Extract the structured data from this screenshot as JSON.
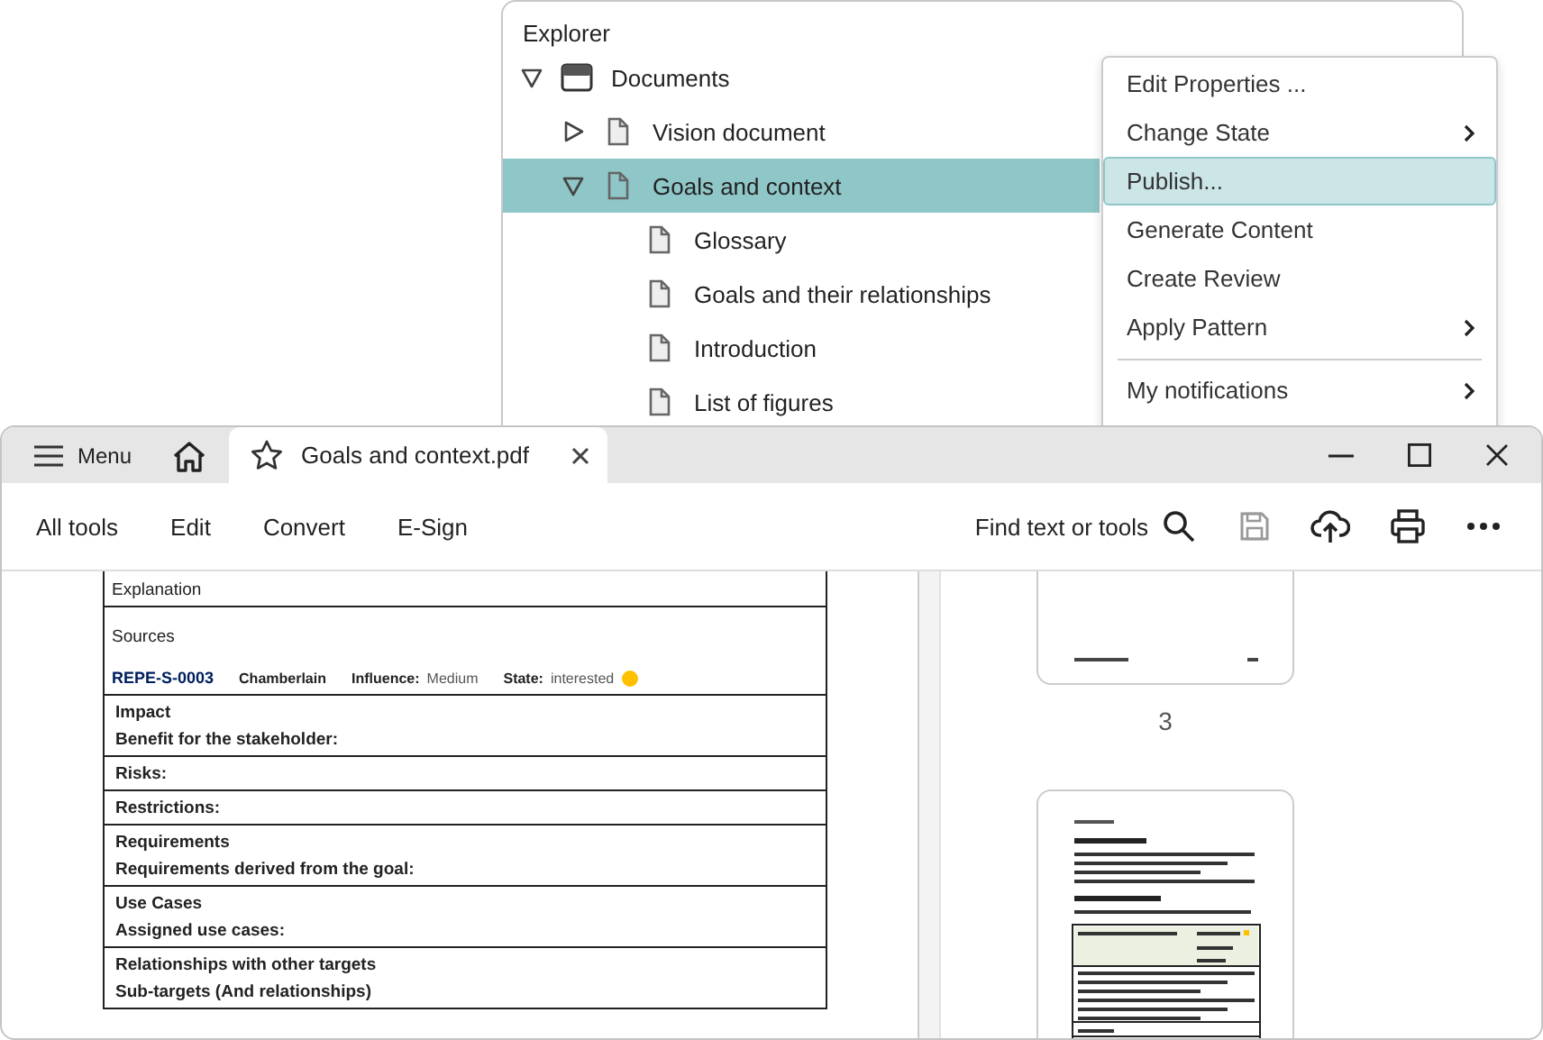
{
  "explorer": {
    "title": "Explorer",
    "tree": [
      {
        "label": "Documents",
        "kind": "folder",
        "expanded": true,
        "selected": false,
        "children": [
          {
            "label": "Vision document",
            "kind": "document",
            "expanded": false,
            "selected": false
          },
          {
            "label": "Goals and context",
            "kind": "document",
            "expanded": true,
            "selected": true,
            "children": [
              {
                "label": "Glossary",
                "kind": "document",
                "selected": false
              },
              {
                "label": "Goals and their relationships",
                "kind": "document",
                "selected": false
              },
              {
                "label": "Introduction",
                "kind": "document",
                "selected": false
              },
              {
                "label": "List of figures",
                "kind": "document",
                "selected": false
              }
            ]
          }
        ]
      }
    ]
  },
  "context_menu": {
    "items": [
      {
        "kind": "item",
        "label": "Edit Properties ...",
        "submenu": false,
        "selected": false
      },
      {
        "kind": "item",
        "label": "Change State",
        "submenu": true,
        "selected": false
      },
      {
        "kind": "item",
        "label": "Publish...",
        "submenu": false,
        "selected": true
      },
      {
        "kind": "item",
        "label": "Generate Content",
        "submenu": false,
        "selected": false
      },
      {
        "kind": "item",
        "label": "Create Review",
        "submenu": false,
        "selected": false
      },
      {
        "kind": "item",
        "label": "Apply Pattern",
        "submenu": true,
        "selected": false
      },
      {
        "kind": "separator"
      },
      {
        "kind": "item",
        "label": "My notifications",
        "submenu": true,
        "selected": false
      }
    ]
  },
  "pdf_window": {
    "menu_button": "Menu",
    "tab": {
      "title": "Goals and context.pdf",
      "selected": true
    },
    "tools": [
      "All tools",
      "Edit",
      "Convert",
      "E-Sign"
    ],
    "search_label": "Find text or tools",
    "actions": [
      {
        "kind": "save",
        "disabled": true
      },
      {
        "kind": "upload",
        "disabled": false
      },
      {
        "kind": "print",
        "disabled": false
      },
      {
        "kind": "more",
        "disabled": false
      }
    ],
    "document": {
      "rows": [
        {
          "kind": "plain",
          "lines": [
            "Explanation"
          ]
        },
        {
          "kind": "sources",
          "title": "Sources",
          "entry": {
            "id": "REPE-S-0003",
            "name": "Chamberlain",
            "influence_label": "Influence:",
            "influence": "Medium",
            "state_label": "State:",
            "state": "interested",
            "color": "#ffc000"
          }
        },
        {
          "kind": "section",
          "lines": [
            "Impact",
            "Benefit for the stakeholder:"
          ]
        },
        {
          "kind": "section",
          "lines": [
            "Risks:"
          ]
        },
        {
          "kind": "section",
          "lines": [
            "Restrictions:"
          ]
        },
        {
          "kind": "section",
          "lines": [
            "Requirements",
            "Requirements derived from the goal:"
          ]
        },
        {
          "kind": "section",
          "lines": [
            "Use Cases",
            "Assigned use cases:"
          ]
        },
        {
          "kind": "section",
          "lines": [
            "Relationships with other targets",
            "Sub-targets (And relationships)"
          ]
        }
      ]
    },
    "thumbnails": {
      "page_number": "3"
    }
  }
}
